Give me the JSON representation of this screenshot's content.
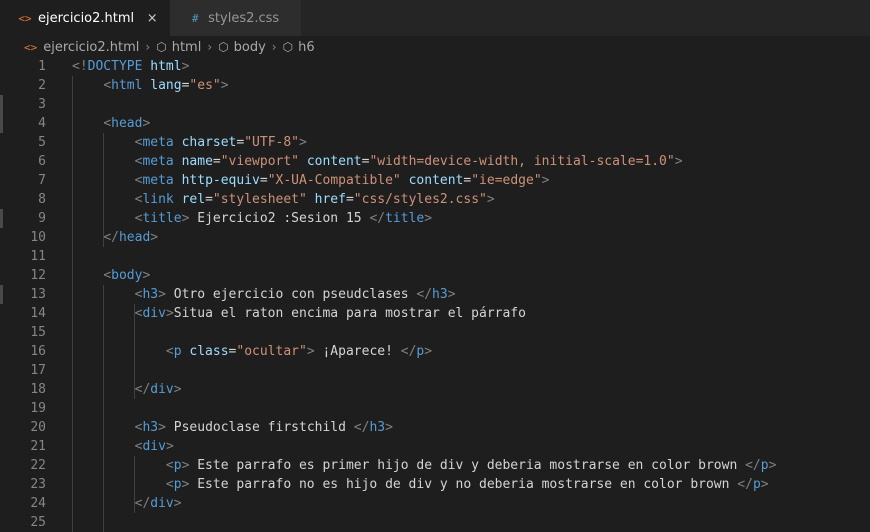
{
  "tabs": [
    {
      "icon": "<>",
      "label": "ejercicio2.html",
      "close": "×",
      "active": true
    },
    {
      "icon": "#",
      "label": "styles2.css",
      "active": false
    }
  ],
  "breadcrumb": [
    "ejercicio2.html",
    "html",
    "body",
    "h6"
  ],
  "colors": {
    "tag": "#569cd6",
    "attr": "#9cdcfe",
    "string": "#ce9178",
    "text": "#d4d4d4",
    "bracket": "#808080"
  },
  "lines": [
    {
      "n": "1",
      "tokens": [
        [
          "b",
          "<!"
        ],
        [
          "t",
          "DOCTYPE "
        ],
        [
          "a",
          "html"
        ],
        [
          "b",
          ">"
        ]
      ]
    },
    {
      "n": "2",
      "tokens": [
        [
          "x",
          "    "
        ],
        [
          "b",
          "<"
        ],
        [
          "t",
          "html "
        ],
        [
          "a",
          "lang"
        ],
        [
          "x",
          "="
        ],
        [
          "s",
          "\"es\""
        ],
        [
          "b",
          ">"
        ]
      ]
    },
    {
      "n": "3",
      "tokens": []
    },
    {
      "n": "4",
      "tokens": [
        [
          "x",
          "    "
        ],
        [
          "b",
          "<"
        ],
        [
          "t",
          "head"
        ],
        [
          "b",
          ">"
        ]
      ]
    },
    {
      "n": "5",
      "tokens": [
        [
          "x",
          "        "
        ],
        [
          "b",
          "<"
        ],
        [
          "t",
          "meta "
        ],
        [
          "a",
          "charset"
        ],
        [
          "x",
          "="
        ],
        [
          "s",
          "\"UTF-8\""
        ],
        [
          "b",
          ">"
        ]
      ]
    },
    {
      "n": "6",
      "tokens": [
        [
          "x",
          "        "
        ],
        [
          "b",
          "<"
        ],
        [
          "t",
          "meta "
        ],
        [
          "a",
          "name"
        ],
        [
          "x",
          "="
        ],
        [
          "s",
          "\"viewport\""
        ],
        [
          "x",
          " "
        ],
        [
          "a",
          "content"
        ],
        [
          "x",
          "="
        ],
        [
          "s",
          "\"width=device-width, initial-scale=1.0\""
        ],
        [
          "b",
          ">"
        ]
      ]
    },
    {
      "n": "7",
      "tokens": [
        [
          "x",
          "        "
        ],
        [
          "b",
          "<"
        ],
        [
          "t",
          "meta "
        ],
        [
          "a",
          "http-equiv"
        ],
        [
          "x",
          "="
        ],
        [
          "s",
          "\"X-UA-Compatible\""
        ],
        [
          "x",
          " "
        ],
        [
          "a",
          "content"
        ],
        [
          "x",
          "="
        ],
        [
          "s",
          "\"ie=edge\""
        ],
        [
          "b",
          ">"
        ]
      ]
    },
    {
      "n": "8",
      "tokens": [
        [
          "x",
          "        "
        ],
        [
          "b",
          "<"
        ],
        [
          "t",
          "link "
        ],
        [
          "a",
          "rel"
        ],
        [
          "x",
          "="
        ],
        [
          "s",
          "\"stylesheet\""
        ],
        [
          "x",
          " "
        ],
        [
          "a",
          "href"
        ],
        [
          "x",
          "="
        ],
        [
          "s",
          "\"css/styles2.css\""
        ],
        [
          "b",
          ">"
        ]
      ]
    },
    {
      "n": "9",
      "tokens": [
        [
          "x",
          "        "
        ],
        [
          "b",
          "<"
        ],
        [
          "t",
          "title"
        ],
        [
          "b",
          ">"
        ],
        [
          "x",
          " Ejercicio2 :Sesion 15 "
        ],
        [
          "b",
          "</"
        ],
        [
          "t",
          "title"
        ],
        [
          "b",
          ">"
        ]
      ]
    },
    {
      "n": "10",
      "tokens": [
        [
          "x",
          "    "
        ],
        [
          "b",
          "</"
        ],
        [
          "t",
          "head"
        ],
        [
          "b",
          ">"
        ]
      ]
    },
    {
      "n": "11",
      "tokens": []
    },
    {
      "n": "12",
      "tokens": [
        [
          "x",
          "    "
        ],
        [
          "b",
          "<"
        ],
        [
          "t",
          "body"
        ],
        [
          "b",
          ">"
        ]
      ]
    },
    {
      "n": "13",
      "tokens": [
        [
          "x",
          "        "
        ],
        [
          "b",
          "<"
        ],
        [
          "t",
          "h3"
        ],
        [
          "b",
          ">"
        ],
        [
          "x",
          " Otro ejercicio con pseudclases "
        ],
        [
          "b",
          "</"
        ],
        [
          "t",
          "h3"
        ],
        [
          "b",
          ">"
        ]
      ]
    },
    {
      "n": "14",
      "tokens": [
        [
          "x",
          "        "
        ],
        [
          "b",
          "<"
        ],
        [
          "t",
          "div"
        ],
        [
          "b",
          ">"
        ],
        [
          "x",
          "Situa el raton encima para mostrar el párrafo"
        ]
      ]
    },
    {
      "n": "15",
      "tokens": []
    },
    {
      "n": "16",
      "tokens": [
        [
          "x",
          "            "
        ],
        [
          "b",
          "<"
        ],
        [
          "t",
          "p "
        ],
        [
          "a",
          "class"
        ],
        [
          "x",
          "="
        ],
        [
          "s",
          "\"ocultar\""
        ],
        [
          "b",
          ">"
        ],
        [
          "x",
          " ¡Aparece! "
        ],
        [
          "b",
          "</"
        ],
        [
          "t",
          "p"
        ],
        [
          "b",
          ">"
        ]
      ]
    },
    {
      "n": "17",
      "tokens": []
    },
    {
      "n": "18",
      "tokens": [
        [
          "x",
          "        "
        ],
        [
          "b",
          "</"
        ],
        [
          "t",
          "div"
        ],
        [
          "b",
          ">"
        ]
      ]
    },
    {
      "n": "19",
      "tokens": []
    },
    {
      "n": "20",
      "tokens": [
        [
          "x",
          "        "
        ],
        [
          "b",
          "<"
        ],
        [
          "t",
          "h3"
        ],
        [
          "b",
          ">"
        ],
        [
          "x",
          " Pseudoclase firstchild "
        ],
        [
          "b",
          "</"
        ],
        [
          "t",
          "h3"
        ],
        [
          "b",
          ">"
        ]
      ]
    },
    {
      "n": "21",
      "tokens": [
        [
          "x",
          "        "
        ],
        [
          "b",
          "<"
        ],
        [
          "t",
          "div"
        ],
        [
          "b",
          ">"
        ]
      ]
    },
    {
      "n": "22",
      "tokens": [
        [
          "x",
          "            "
        ],
        [
          "b",
          "<"
        ],
        [
          "t",
          "p"
        ],
        [
          "b",
          ">"
        ],
        [
          "x",
          " Este parrafo es primer hijo de div y deberia mostrarse en color brown "
        ],
        [
          "b",
          "</"
        ],
        [
          "t",
          "p"
        ],
        [
          "b",
          ">"
        ]
      ]
    },
    {
      "n": "23",
      "tokens": [
        [
          "x",
          "            "
        ],
        [
          "b",
          "<"
        ],
        [
          "t",
          "p"
        ],
        [
          "b",
          ">"
        ],
        [
          "x",
          " Este parrafo no es hijo de div y no deberia mostrarse en color brown "
        ],
        [
          "b",
          "</"
        ],
        [
          "t",
          "p"
        ],
        [
          "b",
          ">"
        ]
      ]
    },
    {
      "n": "24",
      "tokens": [
        [
          "x",
          "        "
        ],
        [
          "b",
          "</"
        ],
        [
          "t",
          "div"
        ],
        [
          "b",
          ">"
        ]
      ]
    },
    {
      "n": "25",
      "tokens": []
    }
  ]
}
